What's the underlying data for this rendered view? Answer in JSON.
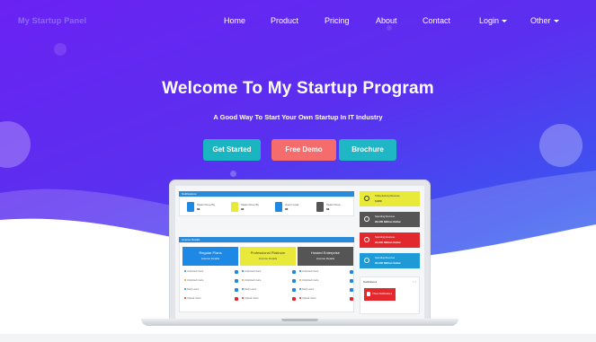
{
  "nav": {
    "brand": "My Startup Panel",
    "items": [
      {
        "label": "Home"
      },
      {
        "label": "Product"
      },
      {
        "label": "Pricing"
      },
      {
        "label": "About"
      },
      {
        "label": "Contact"
      },
      {
        "label": "Login",
        "dropdown": true
      },
      {
        "label": "Other",
        "dropdown": true
      }
    ]
  },
  "hero": {
    "title": "Welcome To My Startup Program",
    "subtitle": "A Good Way To Start Your Own Startup In IT Industry",
    "buttons": {
      "get_started": "Get Started",
      "free_demo": "Free Demo",
      "brochure": "Brochure"
    }
  },
  "dashboard": {
    "notifications_title": "Notifications",
    "stats": [
      {
        "label": "Tasks Done By",
        "value": "88",
        "color": "#1e88e5",
        "icon": "phone-icon"
      },
      {
        "label": "Tasks Done By",
        "value": "88",
        "color": "#e9e93a",
        "icon": "forward-icon"
      },
      {
        "label": "Users Load",
        "value": "88",
        "color": "#1e88e5",
        "icon": "user-icon"
      },
      {
        "label": "Tasks Done",
        "value": "88",
        "color": "#555555",
        "icon": "check-icon"
      }
    ],
    "plans_title": "License Details",
    "plans": [
      {
        "name": "Regular Plans",
        "sub": "License Details",
        "color": "#1e88e5"
      },
      {
        "name": "Professional Platinum",
        "sub": "License Details",
        "color": "#e9e93a"
      },
      {
        "name": "Hosted Enterprise",
        "sub": "License Details",
        "color": "#555555"
      }
    ],
    "plan_rows": [
      "Unlimited Users",
      "Unlimited Users",
      "Daily Users",
      "Daily Users",
      "Upload Users",
      "Upload Users"
    ],
    "side_cards": [
      {
        "line1": "Today Earning Revenue",
        "line2": "5,000",
        "color": "#e9e93a",
        "icon": "tag-icon"
      },
      {
        "line1": "Spending Revenue",
        "line2": "20,000 Million Dollar",
        "color": "#555555",
        "icon": "heart-icon"
      },
      {
        "line1": "Spending Revenue",
        "line2": "20,000 Million Dollar",
        "color": "#e2282d",
        "icon": "cloud-icon"
      },
      {
        "line1": "Spending Revenue",
        "line2": "20,000 Million Dollar",
        "color": "#1e9ad6",
        "icon": "chat-icon"
      }
    ],
    "mini_panel": {
      "title": "Notifications",
      "alert": "3 New Notifications"
    }
  },
  "colors": {
    "hero_start": "#6a22f2",
    "hero_end": "#3f7df2",
    "accent_teal": "#19b6c2",
    "accent_coral": "#f56c6c"
  }
}
